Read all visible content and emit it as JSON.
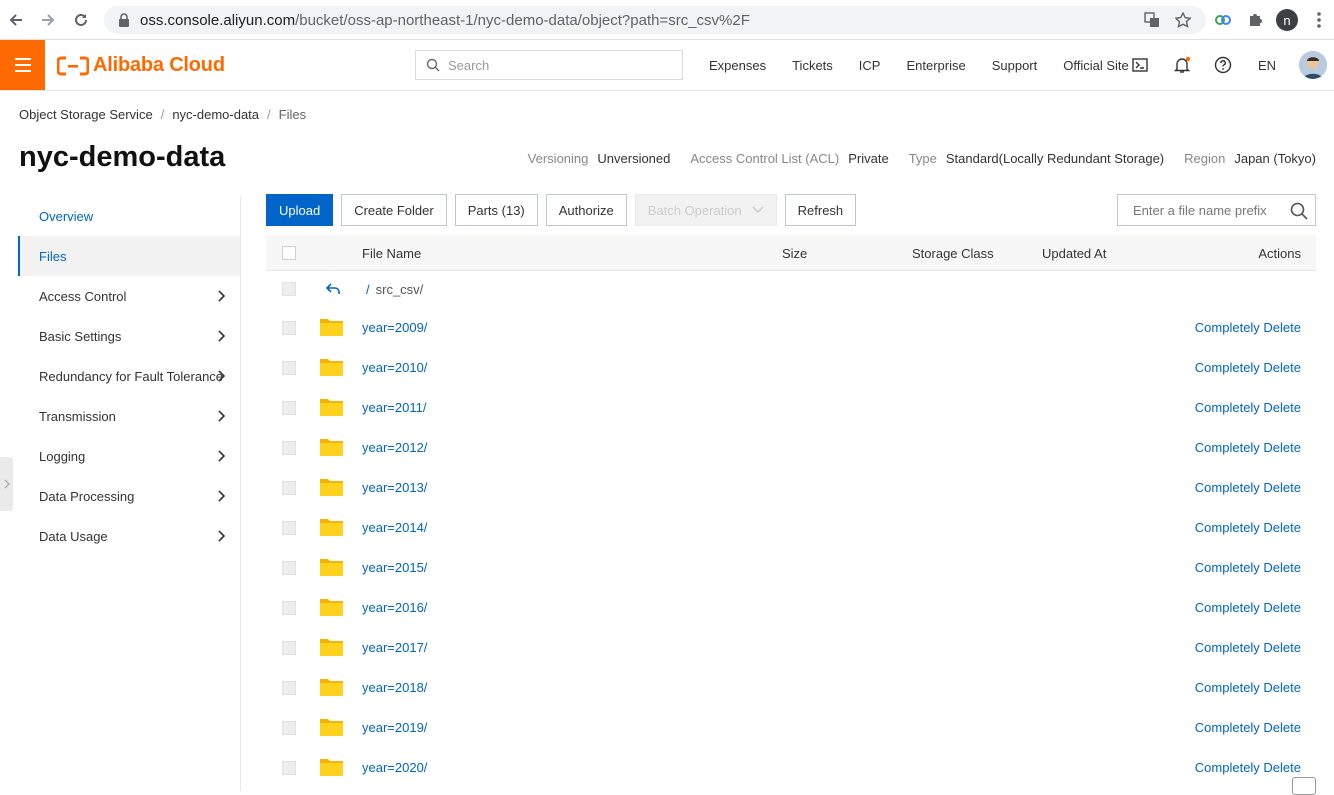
{
  "browser": {
    "url_domain": "oss.console.aliyun.com",
    "url_path": "/bucket/oss-ap-northeast-1/nyc-demo-data/object?path=src_csv%2F",
    "profile_initial": "n"
  },
  "topbar": {
    "logo_text": "Alibaba Cloud",
    "search_placeholder": "Search",
    "links": [
      "Expenses",
      "Tickets",
      "ICP",
      "Enterprise",
      "Support",
      "Official Site"
    ],
    "language": "EN",
    "accent_color": "#ff6a00"
  },
  "breadcrumb": [
    "Object Storage Service",
    "nyc-demo-data",
    "Files"
  ],
  "page": {
    "title": "nyc-demo-data",
    "meta": {
      "versioning_label": "Versioning",
      "versioning_value": "Unversioned",
      "acl_label": "Access Control List (ACL)",
      "acl_value": "Private",
      "type_label": "Type",
      "type_value": "Standard(Locally Redundant Storage)",
      "region_label": "Region",
      "region_value": "Japan (Tokyo)"
    }
  },
  "sidebar": {
    "items": [
      {
        "label": "Overview",
        "state": "link"
      },
      {
        "label": "Files",
        "state": "active"
      },
      {
        "label": "Access Control",
        "state": "expandable"
      },
      {
        "label": "Basic Settings",
        "state": "expandable"
      },
      {
        "label": "Redundancy for Fault Tolerance",
        "state": "expandable"
      },
      {
        "label": "Transmission",
        "state": "expandable"
      },
      {
        "label": "Logging",
        "state": "expandable"
      },
      {
        "label": "Data Processing",
        "state": "expandable"
      },
      {
        "label": "Data Usage",
        "state": "expandable"
      }
    ]
  },
  "toolbar": {
    "upload": "Upload",
    "create_folder": "Create Folder",
    "parts": "Parts (13)",
    "authorize": "Authorize",
    "batch_operation": "Batch Operation",
    "refresh": "Refresh",
    "prefix_placeholder": "Enter a file name prefix"
  },
  "table": {
    "headers": {
      "file_name": "File Name",
      "size": "Size",
      "storage_class": "Storage Class",
      "updated_at": "Updated At",
      "actions": "Actions"
    },
    "parent": {
      "slash": "/",
      "path": "src_csv/"
    },
    "rows": [
      {
        "name": "year=2009/",
        "action": "Completely Delete"
      },
      {
        "name": "year=2010/",
        "action": "Completely Delete"
      },
      {
        "name": "year=2011/",
        "action": "Completely Delete"
      },
      {
        "name": "year=2012/",
        "action": "Completely Delete"
      },
      {
        "name": "year=2013/",
        "action": "Completely Delete"
      },
      {
        "name": "year=2014/",
        "action": "Completely Delete"
      },
      {
        "name": "year=2015/",
        "action": "Completely Delete"
      },
      {
        "name": "year=2016/",
        "action": "Completely Delete"
      },
      {
        "name": "year=2017/",
        "action": "Completely Delete"
      },
      {
        "name": "year=2018/",
        "action": "Completely Delete"
      },
      {
        "name": "year=2019/",
        "action": "Completely Delete"
      },
      {
        "name": "year=2020/",
        "action": "Completely Delete"
      }
    ]
  }
}
